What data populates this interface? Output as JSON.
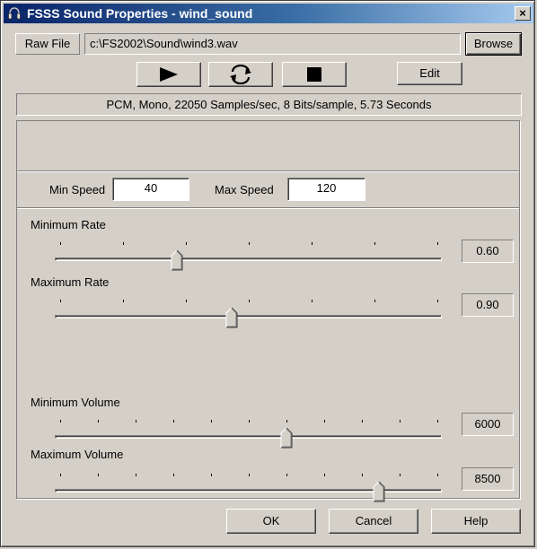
{
  "window": {
    "title": "FSSS Sound Properties - wind_sound",
    "close_label": "×"
  },
  "file": {
    "raw_file_label": "Raw File",
    "path": "c:\\FS2002\\Sound\\wind3.wav",
    "browse_label": "Browse"
  },
  "transport": {
    "edit_label": "Edit"
  },
  "info": {
    "format": "PCM, Mono, 22050 Samples/sec, 8 Bits/sample, 5.73 Seconds"
  },
  "speed": {
    "min_label": "Min Speed",
    "min_value": "40",
    "max_label": "Max Speed",
    "max_value": "120"
  },
  "sliders": {
    "min_rate": {
      "label": "Minimum Rate",
      "value": "0.60",
      "position": 0.31
    },
    "max_rate": {
      "label": "Maximum Rate",
      "value": "0.90",
      "position": 0.455
    },
    "min_volume": {
      "label": "Minimum Volume",
      "value": "6000",
      "position": 0.6
    },
    "max_volume": {
      "label": "Maximum Volume",
      "value": "8500",
      "position": 0.845
    }
  },
  "footer": {
    "ok_label": "OK",
    "cancel_label": "Cancel",
    "help_label": "Help"
  }
}
